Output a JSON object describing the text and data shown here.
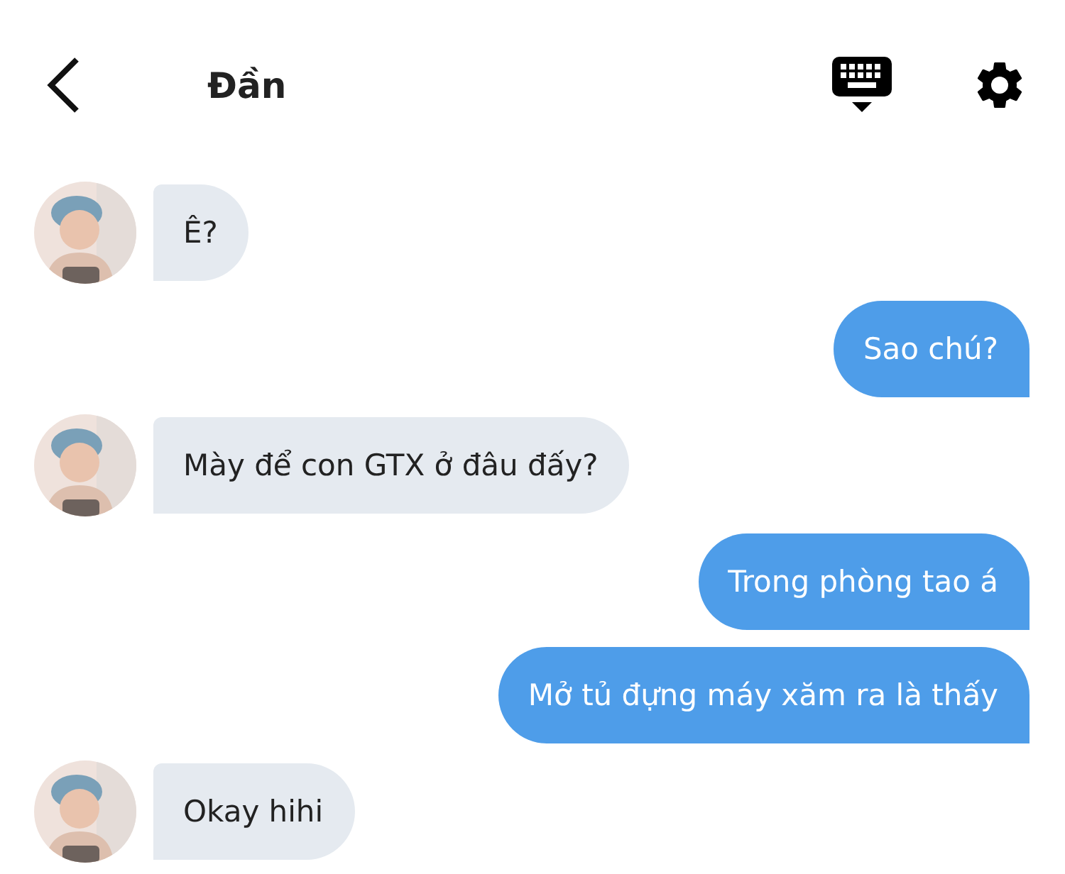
{
  "header": {
    "title": "Đần"
  },
  "messages": [
    {
      "kind": "received",
      "text": "Ê?"
    },
    {
      "kind": "sent",
      "text": "Sao chú?"
    },
    {
      "kind": "received",
      "text": "Mày để con GTX ở đâu đấy?"
    },
    {
      "kind": "sent",
      "text": "Trong phòng tao á"
    },
    {
      "kind": "sent",
      "text": "Mở tủ đựng máy xăm ra là thấy"
    },
    {
      "kind": "received",
      "text": "Okay hihi"
    }
  ]
}
